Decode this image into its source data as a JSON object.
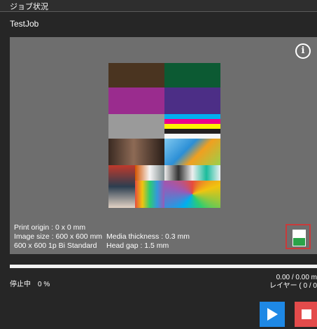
{
  "window": {
    "title": "ジョブ状況"
  },
  "job": {
    "name": "TestJob"
  },
  "preview": {
    "info_icon": "info-circle-icon",
    "print_origin": "Print origin : 0 x 0 mm",
    "image_size": "Image size : 600 x 600 mm",
    "resolution": "600 x 600 1p Bi Standard",
    "media_thickness": "Media thickness : 0.3 mm",
    "head_gap": "Head gap : 1.5 mm",
    "media_button_icon": "media-icon"
  },
  "progress": {
    "fraction": 0,
    "status": "停止中　0 %",
    "length": "0.00 / 0.00 m",
    "layer": "レイヤー ( 0 / 0"
  },
  "controls": {
    "play_icon": "play-icon",
    "stop_icon": "stop-icon"
  },
  "colors": {
    "accent": "#1e88e5",
    "stop": "#e34b4b",
    "media_green": "#2aa348"
  }
}
